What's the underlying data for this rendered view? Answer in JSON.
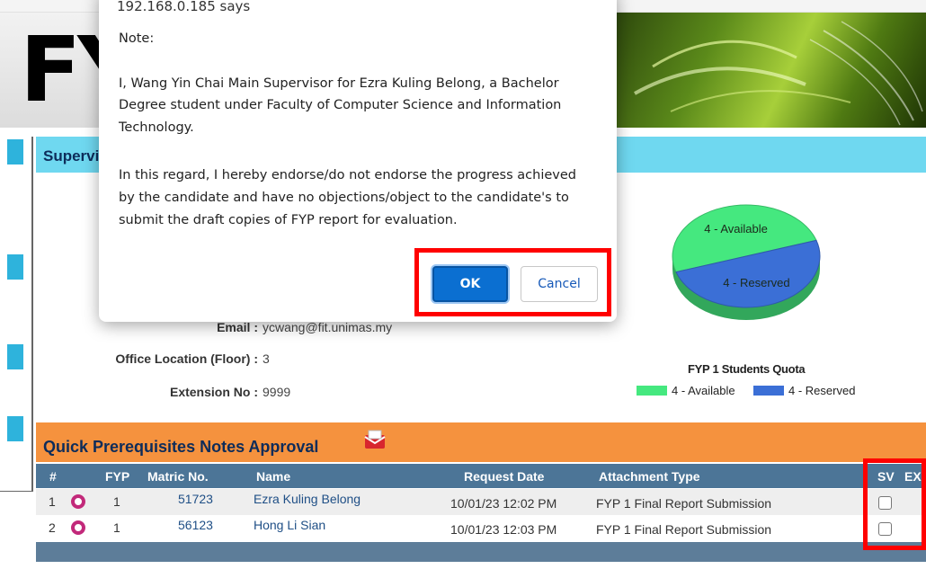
{
  "banner": {
    "logo_text": "FY"
  },
  "supervisor": {
    "header_title": "Supervisor",
    "fields": [
      {
        "label": "Email :",
        "value": "ycwang@fit.unimas.my"
      },
      {
        "label": "Office Location (Floor) :",
        "value": "3"
      },
      {
        "label": "Extension No :",
        "value": "9999"
      }
    ],
    "quota_chart": {
      "title": "FYP 1 Students Quota",
      "legend": [
        {
          "label": "4 - Available",
          "color": "#45e87f"
        },
        {
          "label": "4 - Reserved",
          "color": "#3b6fd6"
        }
      ]
    }
  },
  "chart_data": {
    "type": "pie",
    "title": "FYP 1 Students Quota",
    "slices": [
      {
        "label": "4 - Available",
        "value": 4,
        "color": "#45e87f"
      },
      {
        "label": "4 - Reserved",
        "value": 4,
        "color": "#3b6fd6"
      }
    ],
    "legend_position": "bottom"
  },
  "quick_approval": {
    "title": "Quick Prerequisites Notes Approval",
    "icon": "envelope-icon",
    "columns": [
      "#",
      "FYP",
      "Matric No.",
      "Name",
      "Request Date",
      "Attachment Type",
      "SV",
      "EX"
    ],
    "rows": [
      {
        "num": "1",
        "fyp": "1",
        "matric": "51723",
        "name": "Ezra Kuling Belong",
        "date": "10/01/23 12:02 PM",
        "attachment": "FYP 1 Final Report Submission"
      },
      {
        "num": "2",
        "fyp": "1",
        "matric": "56123",
        "name": "Hong Li Sian",
        "date": "10/01/23 12:03 PM",
        "attachment": "FYP 1 Final Report Submission"
      }
    ]
  },
  "dialog": {
    "origin": "192.168.0.185 says",
    "lines": [
      "Note:",
      "I, Wang Yin Chai Main Supervisor for Ezra Kuling Belong, a Bachelor",
      "Degree student under Faculty of Computer Science and Information",
      "Technology.",
      "In this regard, I hereby endorse/do not endorse the progress achieved",
      "by the candidate and have no objections/object to the candidate's to",
      "submit the draft copies of FYP report for evaluation."
    ],
    "ok_label": "OK",
    "cancel_label": "Cancel"
  },
  "colors": {
    "accent_orange": "#f5923e",
    "accent_cyan": "#6fd8f0",
    "table_header": "#4c7597",
    "ok_blue": "#0b6fd1",
    "annotation_red": "#ff0000"
  }
}
